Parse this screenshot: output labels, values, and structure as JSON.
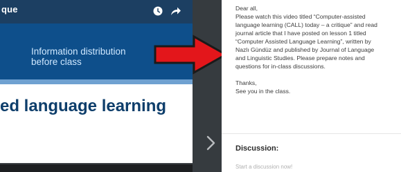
{
  "video": {
    "title_fragment": "que",
    "caption_line1": "Information distribution",
    "caption_line2": "before class",
    "heading": "ed language learning"
  },
  "message": {
    "greeting": "Dear all,",
    "body_lines": [
      "Please watch this video titled “Computer-assisted",
      "language learning (CALL) today – a critique” and read",
      "journal article that I have posted on lesson 1 titled",
      "“Computer Assisted Language Learning”, written by",
      "Nazlı Gündüz and published by Journal of Language",
      "and Linguistic Studies. Please prepare notes and",
      "questions for in-class discussions."
    ],
    "thanks": "Thanks,",
    "closing": "See you in the class."
  },
  "discussion": {
    "label": "Discussion:",
    "placeholder": "Start a discussion now!"
  },
  "colors": {
    "arrow_red": "#e3161b",
    "video_blue": "#0e4f8b",
    "heading_blue": "#0e3e6b",
    "dark_panel": "#363b3f"
  },
  "icons": [
    "clock-icon",
    "share-arrow-icon",
    "chevron-right-icon",
    "red-arrow-annotation"
  ]
}
